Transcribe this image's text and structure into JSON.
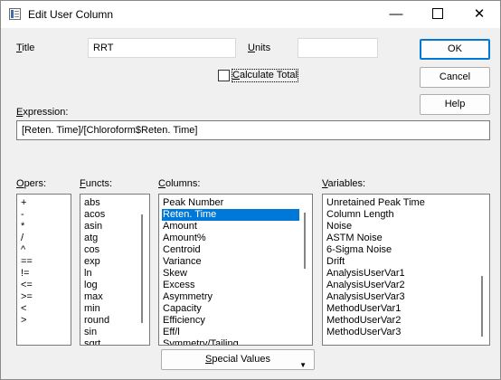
{
  "window": {
    "title": "Edit User Column"
  },
  "title_field": {
    "label_u": "T",
    "label_rest": "itle",
    "value": "RRT"
  },
  "units_field": {
    "label_u": "U",
    "label_rest": "nits",
    "value": ""
  },
  "calc_total": {
    "label_u": "C",
    "label_rest": "alculate Total",
    "checked": false
  },
  "buttons": {
    "ok": "OK",
    "cancel": "Cancel",
    "help": "Help"
  },
  "expression": {
    "label_u": "E",
    "label_rest": "xpression:",
    "value": "[Reten. Time]/[Chloroform$Reten. Time]"
  },
  "opers": {
    "label_u": "O",
    "label_rest": "pers:",
    "items": [
      "+",
      "-",
      "*",
      "/",
      "^",
      "==",
      "!=",
      "<=",
      ">=",
      "<",
      ">"
    ]
  },
  "functs": {
    "label_u": "F",
    "label_rest": "uncts:",
    "items": [
      "abs",
      "acos",
      "asin",
      "atg",
      "cos",
      "exp",
      "ln",
      "log",
      "max",
      "min",
      "round",
      "sin",
      "sqrt"
    ]
  },
  "columns": {
    "label_u": "C",
    "label_rest": "olumns:",
    "selected": "Reten. Time",
    "items": [
      "Peak Number",
      "Reten. Time",
      "Amount",
      "Amount%",
      "Centroid",
      "Variance",
      "Skew",
      "Excess",
      "Asymmetry",
      "Capacity",
      "Efficiency",
      "Eff/l",
      "Symmetry/Tailing"
    ]
  },
  "variables": {
    "label_u": "V",
    "label_rest": "ariables:",
    "items": [
      "Unretained Peak Time",
      "Column Length",
      "Noise",
      "ASTM Noise",
      "6-Sigma Noise",
      "Drift",
      "AnalysisUserVar1",
      "AnalysisUserVar2",
      "AnalysisUserVar3",
      "MethodUserVar1",
      "MethodUserVar2",
      "MethodUserVar3"
    ]
  },
  "special_values": {
    "label_u": "S",
    "label_rest": "pecial Values",
    "arrow": "▼"
  }
}
